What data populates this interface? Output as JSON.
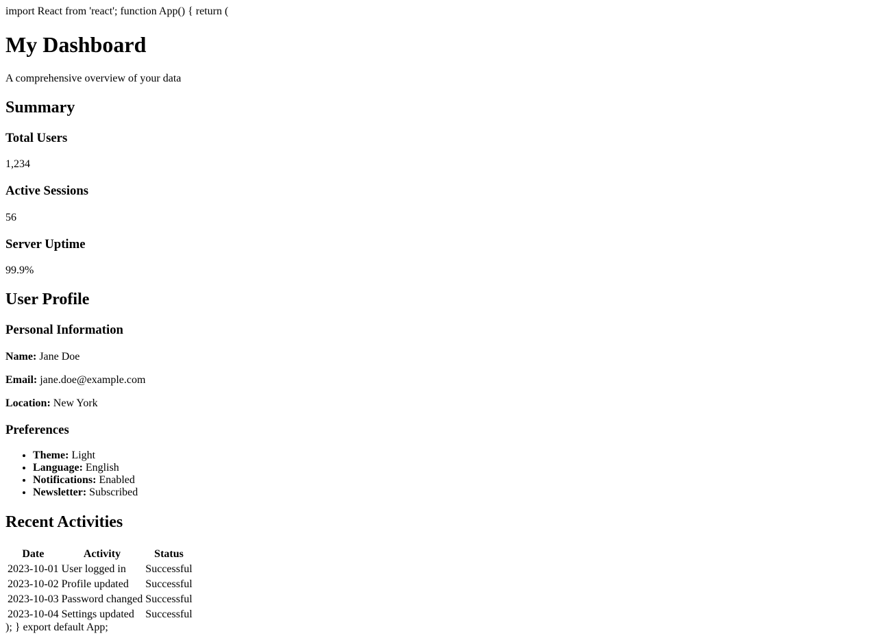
{
  "code": {
    "top": "import React from 'react'; function App() { return (",
    "bottom": "); } export default App;"
  },
  "header": {
    "title": "My Dashboard",
    "subtitle": "A comprehensive overview of your data"
  },
  "summary": {
    "heading": "Summary",
    "stats": [
      {
        "label": "Total Users",
        "value": "1,234"
      },
      {
        "label": "Active Sessions",
        "value": "56"
      },
      {
        "label": "Server Uptime",
        "value": "99.9%"
      }
    ]
  },
  "profile": {
    "heading": "User Profile",
    "personal": {
      "heading": "Personal Information",
      "name_label": "Name:",
      "name_value": "Jane Doe",
      "email_label": "Email:",
      "email_value": "jane.doe@example.com",
      "location_label": "Location:",
      "location_value": "New York"
    },
    "preferences": {
      "heading": "Preferences",
      "items": [
        {
          "label": "Theme:",
          "value": "Light"
        },
        {
          "label": "Language:",
          "value": "English"
        },
        {
          "label": "Notifications:",
          "value": "Enabled"
        },
        {
          "label": "Newsletter:",
          "value": "Subscribed"
        }
      ]
    }
  },
  "activities": {
    "heading": "Recent Activities",
    "columns": [
      "Date",
      "Activity",
      "Status"
    ],
    "rows": [
      [
        "2023-10-01",
        "User logged in",
        "Successful"
      ],
      [
        "2023-10-02",
        "Profile updated",
        "Successful"
      ],
      [
        "2023-10-03",
        "Password changed",
        "Successful"
      ],
      [
        "2023-10-04",
        "Settings updated",
        "Successful"
      ]
    ]
  }
}
